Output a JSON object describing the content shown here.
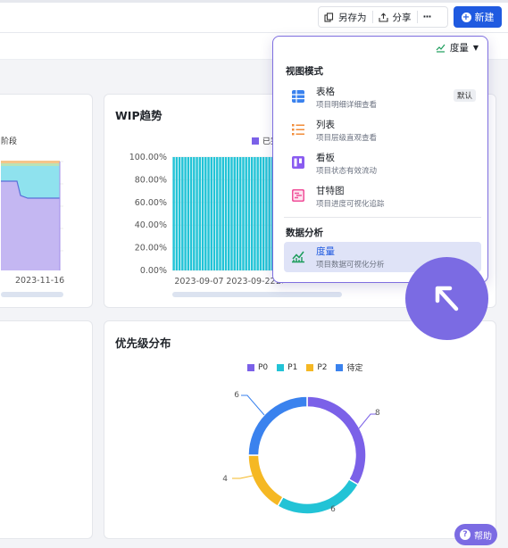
{
  "toolbar": {
    "save_as_label": "另存为",
    "share_label": "分享",
    "more_label": "···",
    "new_label": "新建"
  },
  "left_card": {
    "legend_text": "阶段",
    "x_tick": "2023-11-16"
  },
  "wip_card": {
    "title": "WIP趋势",
    "legend_text": "已完",
    "y_ticks": [
      "100.00%",
      "80.00%",
      "60.00%",
      "40.00%",
      "20.00%",
      "0.00%"
    ],
    "x_ticks": [
      "2023-09-07",
      "2023-09-22",
      "20"
    ],
    "bar_color": "#22c3d6",
    "bar_count": 37
  },
  "priority_card": {
    "title": "优先级分布",
    "legend": [
      {
        "label": "P0",
        "color": "#7b61e8"
      },
      {
        "label": "P1",
        "color": "#22c3d6"
      },
      {
        "label": "P2",
        "color": "#f5b824"
      },
      {
        "label": "待定",
        "color": "#3a82ee"
      }
    ],
    "data_labels": [
      "8",
      "6",
      "4",
      "6"
    ]
  },
  "chart_data": [
    {
      "type": "bar",
      "title": "WIP趋势",
      "ylim": [
        0,
        100
      ],
      "x_ticks_visible": [
        "2023-09-07",
        "2023-09-22"
      ],
      "series": [
        {
          "name": "已完",
          "values": [
            100,
            100,
            100,
            100,
            100,
            100,
            100,
            100,
            100,
            100,
            100,
            100,
            100,
            100,
            100,
            100,
            100,
            100,
            100,
            100,
            100,
            100,
            100,
            100,
            100,
            100,
            100,
            100,
            100,
            100,
            100,
            100,
            100,
            100,
            100,
            100,
            100
          ]
        }
      ]
    },
    {
      "type": "pie",
      "title": "优先级分布",
      "categories": [
        "P0",
        "P1",
        "P2",
        "待定"
      ],
      "values": [
        8,
        6,
        4,
        6
      ],
      "colors": [
        "#7b61e8",
        "#22c3d6",
        "#f5b824",
        "#3a82ee"
      ],
      "donut": true
    }
  ],
  "dropdown": {
    "header_label": "度量",
    "view_section": "视图模式",
    "items": [
      {
        "title": "表格",
        "desc": "项目明细详细查看",
        "badge": "默认"
      },
      {
        "title": "列表",
        "desc": "项目层级直观查看"
      },
      {
        "title": "看板",
        "desc": "项目状态有效流动"
      },
      {
        "title": "甘特图",
        "desc": "项目进度可视化追踪"
      }
    ],
    "analysis_section": "数据分析",
    "analysis_items": [
      {
        "title": "度量",
        "desc": "项目数据可视化分析"
      }
    ]
  },
  "help": {
    "label": "帮助"
  },
  "colors": {
    "accent": "#1f5ae0",
    "purple": "#7b6be3"
  }
}
